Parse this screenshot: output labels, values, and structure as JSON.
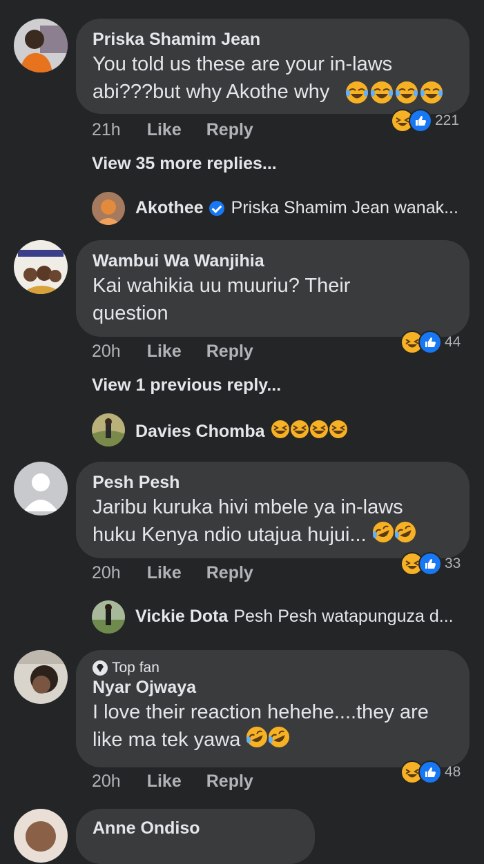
{
  "comments": [
    {
      "name": "Priska Shamim Jean",
      "text": "You told us these are your in-laws abi???but why Akothe why",
      "time": "21h",
      "like": "Like",
      "reply": "Reply",
      "reaction_count": "221",
      "view_more": "View 35 more replies...",
      "reply_preview": {
        "name": "Akothee",
        "text": "Priska Shamim Jean wanak..."
      }
    },
    {
      "name": "Wambui Wa Wanjihia",
      "text_line1": "Kai wahikia uu muuriu? Their",
      "text_line2": "question",
      "time": "20h",
      "like": "Like",
      "reply": "Reply",
      "reaction_count": "44",
      "view_more": "View 1 previous reply...",
      "reply_preview": {
        "name": "Davies Chomba",
        "text": ""
      }
    },
    {
      "name": "Pesh Pesh",
      "text_line1": "Jaribu kuruka hivi mbele ya in-laws",
      "text_line2": "huku Kenya ndio utajua hujui...",
      "time": "20h",
      "like": "Like",
      "reply": "Reply",
      "reaction_count": "33",
      "reply_preview": {
        "name": "Vickie Dota",
        "text": "Pesh Pesh watapunguza d..."
      }
    },
    {
      "badge": "Top fan",
      "name": "Nyar Ojwaya",
      "text_line1": "I love their reaction hehehe....they are",
      "text_line2": "like ma tek yawa",
      "time": "20h",
      "like": "Like",
      "reply": "Reply",
      "reaction_count": "48"
    },
    {
      "name": "Anne Ondiso"
    }
  ],
  "colors": {
    "background": "#242526",
    "bubble": "#3a3b3c",
    "like_blue": "#1877f2",
    "haha_yellow": "#f7b125"
  },
  "icons": [
    "laughing-tears-emoji",
    "grinning-squint-emoji",
    "rolling-laughing-emoji",
    "like-icon",
    "haha-icon",
    "verified-icon",
    "diamond-icon"
  ]
}
